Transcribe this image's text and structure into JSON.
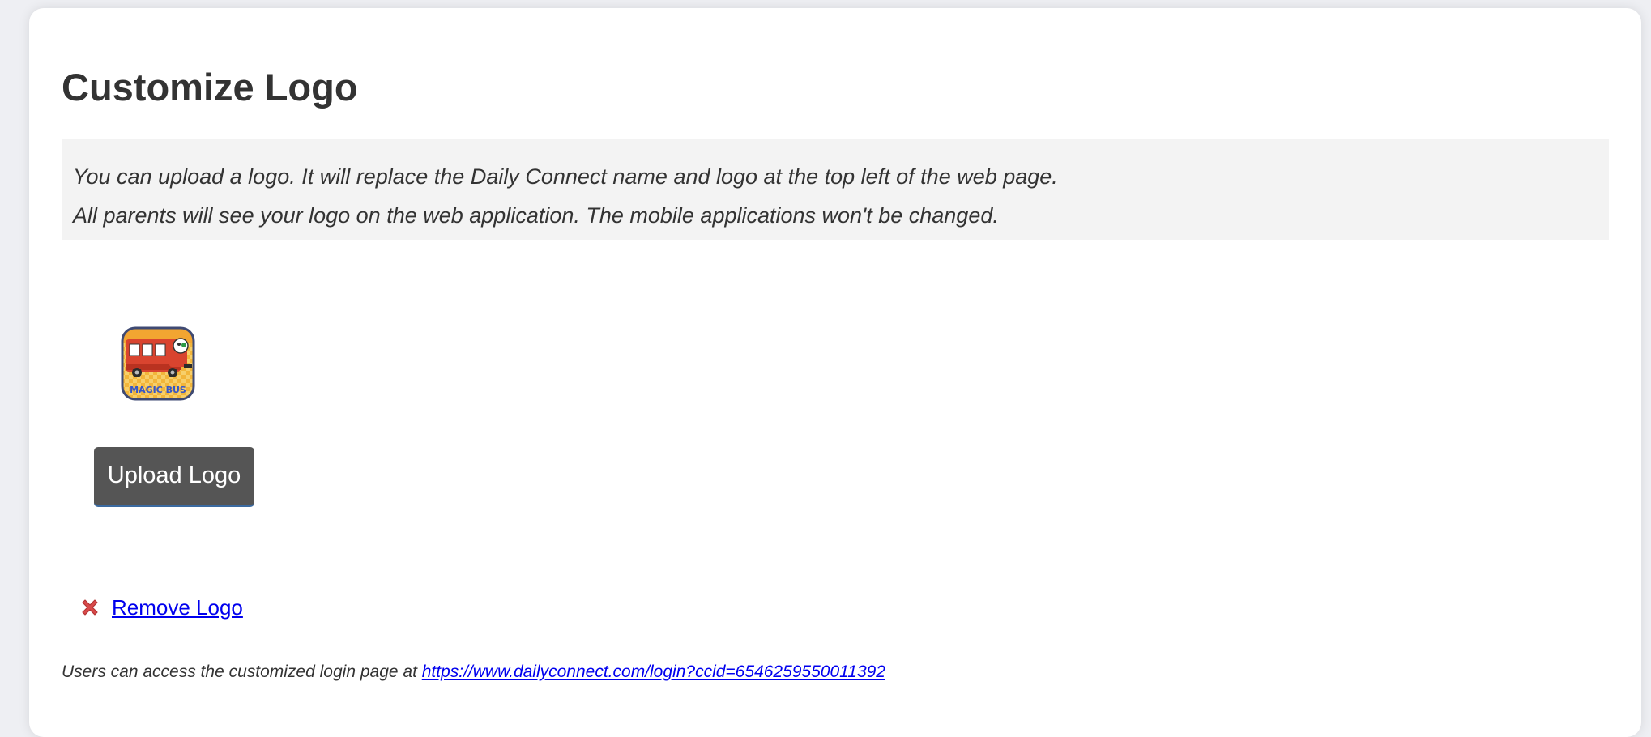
{
  "page": {
    "title": "Customize Logo"
  },
  "info": {
    "line1": "You can upload a logo. It will replace the Daily Connect name and logo at the top left of the web page.",
    "line2": "All parents will see your logo on the web application. The mobile applications won't be changed."
  },
  "logo": {
    "image_icon": "magic-bus-logo",
    "text": "MAGIC BUS"
  },
  "actions": {
    "upload_label": "Upload Logo",
    "remove_label": "Remove Logo",
    "remove_icon": "close-icon"
  },
  "footer": {
    "prefix": "Users can access the customized login page at ",
    "link_text": "https://www.dailyconnect.com/login?ccid=6546259550011392"
  },
  "colors": {
    "button_bg": "#555555",
    "link": "#0000ee",
    "info_bg": "#f3f3f3"
  }
}
